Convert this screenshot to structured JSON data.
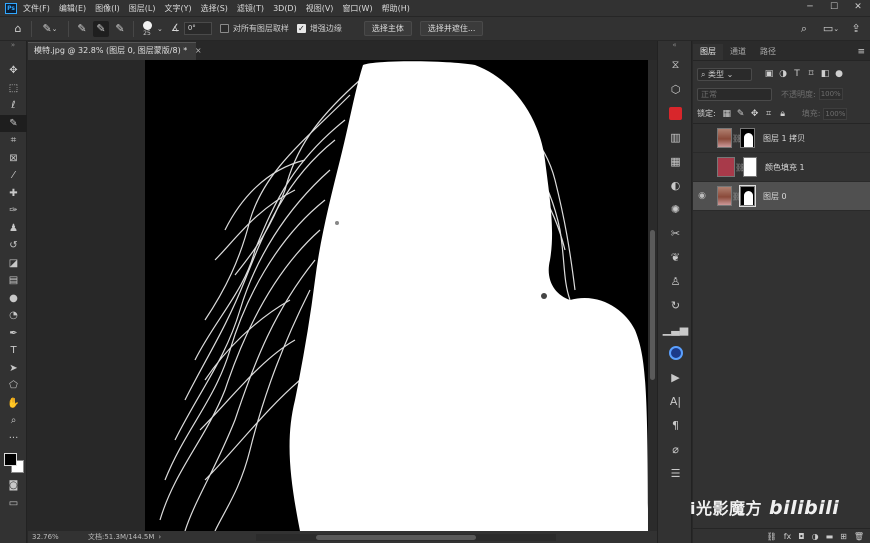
{
  "menubar": {
    "logo": "Ps",
    "items": [
      "文件(F)",
      "编辑(E)",
      "图像(I)",
      "图层(L)",
      "文字(Y)",
      "选择(S)",
      "滤镜(T)",
      "3D(D)",
      "视图(V)",
      "窗口(W)",
      "帮助(H)"
    ],
    "window_controls": [
      "─",
      "☐",
      "✕"
    ]
  },
  "options": {
    "brush_size": "25",
    "angle": "0°",
    "sample_all_layers": "对所有图层取样",
    "enhance_edge": "增强边缘",
    "select_subject": "选择主体",
    "select_and_mask": "选择并遮住..."
  },
  "document": {
    "tab_title": "模特.jpg @ 32.8% (图层 0, 图层蒙版/8) *",
    "tab_close": "×"
  },
  "status": {
    "zoom": "32.76%",
    "doc_info": "文档:51.3M/144.5M"
  },
  "layers_panel": {
    "tabs": [
      "图层",
      "通道",
      "路径"
    ],
    "filter_kind": "类型",
    "blend_mode": "正常",
    "opacity_label": "不透明度:",
    "opacity_value": "100%",
    "lock_label": "锁定:",
    "fill_label": "填充:",
    "fill_value": "100%",
    "layers": [
      {
        "name": "图层 1 拷贝",
        "visible": false,
        "selected": false
      },
      {
        "name": "颜色填充 1",
        "visible": false,
        "selected": false
      },
      {
        "name": "图层 0",
        "visible": true,
        "selected": true
      }
    ],
    "bottom_icons": [
      "link-icon",
      "fx",
      "mask-icon",
      "adjustment-icon",
      "folder-icon",
      "new-layer-icon",
      "trash-icon"
    ]
  },
  "watermark": {
    "text": "i光影魔方",
    "logo": "bilibili"
  }
}
